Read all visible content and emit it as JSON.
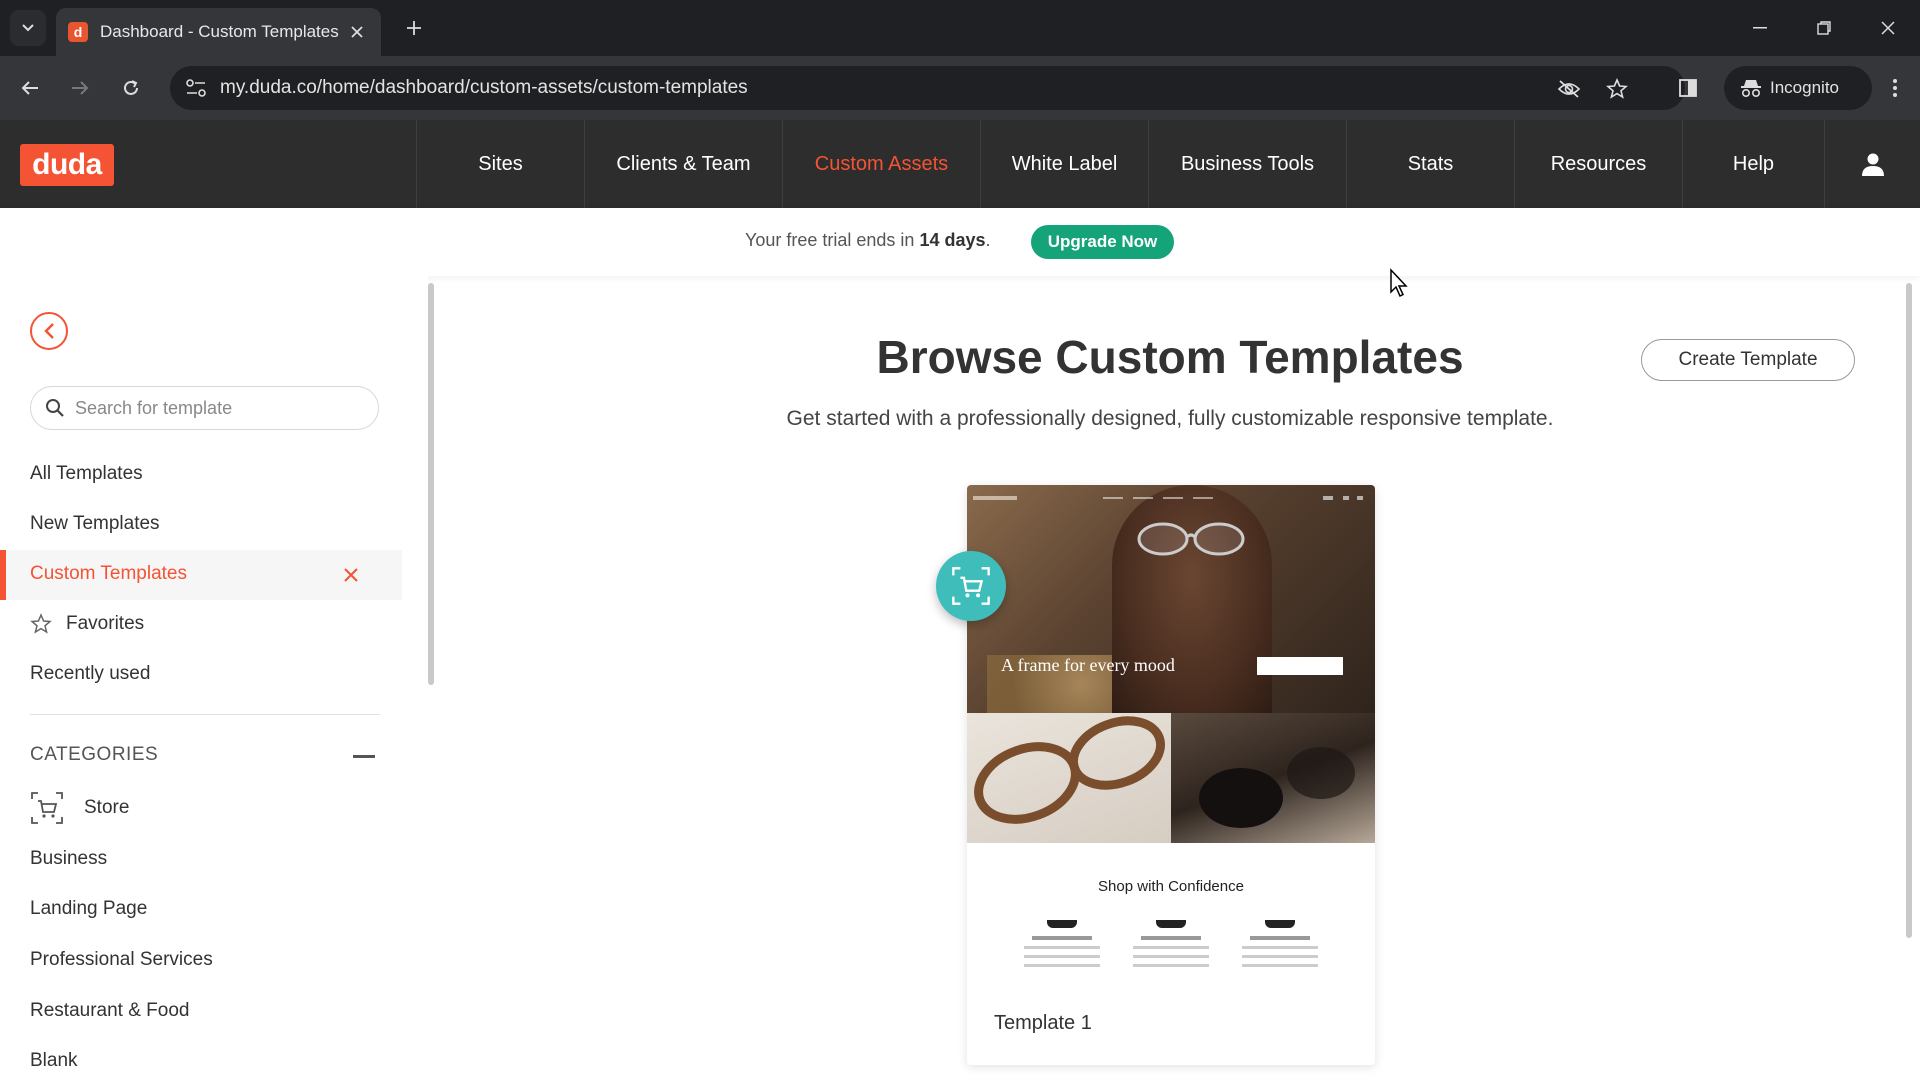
{
  "browser": {
    "tab_title": "Dashboard - Custom Templates",
    "favicon_letter": "d",
    "url": "my.duda.co/home/dashboard/custom-assets/custom-templates",
    "incognito_label": "Incognito"
  },
  "app_nav": {
    "logo": "duda",
    "items": [
      {
        "label": "Sites",
        "active": false
      },
      {
        "label": "Clients & Team",
        "active": false
      },
      {
        "label": "Custom Assets",
        "active": true
      },
      {
        "label": "White Label",
        "active": false
      },
      {
        "label": "Business Tools",
        "active": false
      },
      {
        "label": "Stats",
        "active": false
      },
      {
        "label": "Resources",
        "active": false
      },
      {
        "label": "Help",
        "active": false
      }
    ]
  },
  "trial_banner": {
    "text_before": "Your free trial ends in",
    "days": "14 days",
    "text_after": ".",
    "button": "Upgrade Now"
  },
  "sidebar": {
    "search_placeholder": "Search for template",
    "items": [
      "All Templates",
      "New Templates",
      "Custom Templates",
      "Favorites",
      "Recently used"
    ],
    "active_item": "Custom Templates",
    "categories_heading": "CATEGORIES",
    "categories": [
      "Store",
      "Business",
      "Landing Page",
      "Professional Services",
      "Restaurant & Food",
      "Blank"
    ]
  },
  "main": {
    "title": "Browse Custom Templates",
    "subtitle": "Get started with a professionally designed, fully customizable responsive template.",
    "create_button": "Create Template",
    "templates": [
      {
        "name": "Template 1",
        "preview_hero_text": "A frame for every mood",
        "preview_section_title": "Shop with Confidence"
      }
    ]
  },
  "colors": {
    "accent": "#f45334",
    "nav_bg": "#2d2d2d",
    "upgrade": "#15a37a",
    "store_badge": "#3fbdbb"
  }
}
